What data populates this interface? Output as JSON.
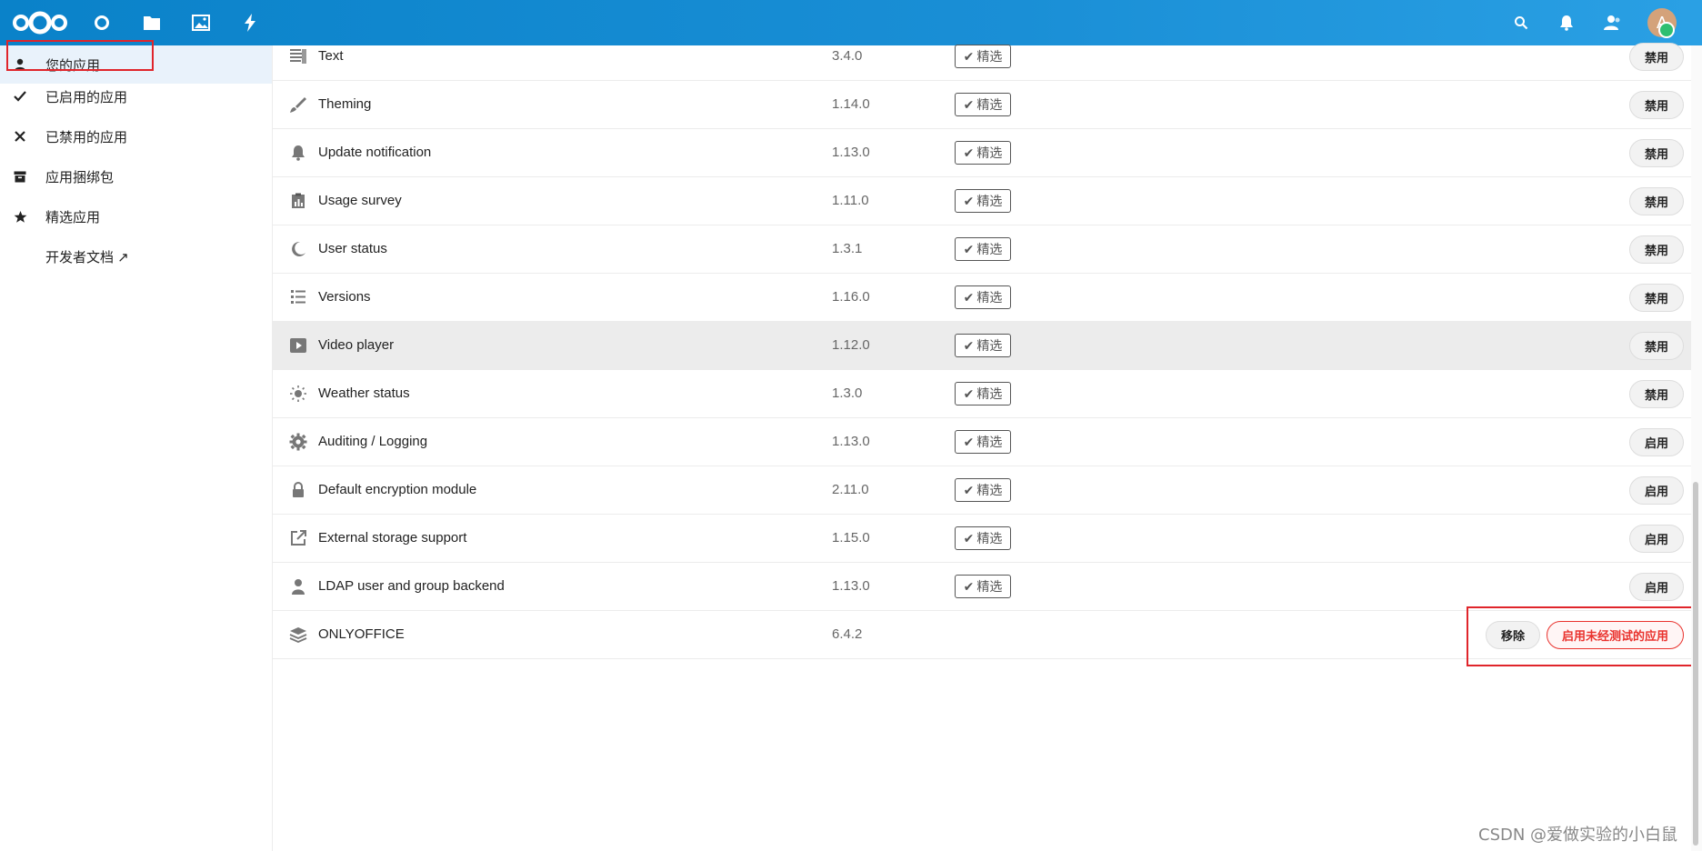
{
  "colors": {
    "header": "#0a82c9",
    "accent": "#e0252b",
    "danger": "#e9322d",
    "online": "#2fbf71"
  },
  "header": {
    "avatar_letter": "A",
    "apps": [
      "dashboard-icon",
      "files-icon",
      "photos-icon",
      "activity-icon"
    ],
    "right": [
      "search-icon",
      "bell-icon",
      "contacts-icon"
    ]
  },
  "sidebar": {
    "items": [
      {
        "label": "您的应用",
        "icon": "user-icon"
      },
      {
        "label": "已启用的应用",
        "icon": "check-icon"
      },
      {
        "label": "已禁用的应用",
        "icon": "close-icon"
      },
      {
        "label": "应用捆绑包",
        "icon": "archive-icon"
      },
      {
        "label": "精选应用",
        "icon": "star-icon"
      },
      {
        "label": "开发者文档 ↗",
        "icon": ""
      }
    ]
  },
  "apps": [
    {
      "name": "Text",
      "version": "3.4.0",
      "badge": "精选",
      "action": "禁用",
      "icon": "text-icon"
    },
    {
      "name": "Theming",
      "version": "1.14.0",
      "badge": "精选",
      "action": "禁用",
      "icon": "brush-icon"
    },
    {
      "name": "Update notification",
      "version": "1.13.0",
      "badge": "精选",
      "action": "禁用",
      "icon": "bell-icon"
    },
    {
      "name": "Usage survey",
      "version": "1.11.0",
      "badge": "精选",
      "action": "禁用",
      "icon": "clipboard-chart-icon"
    },
    {
      "name": "User status",
      "version": "1.3.1",
      "badge": "精选",
      "action": "禁用",
      "icon": "moon-icon"
    },
    {
      "name": "Versions",
      "version": "1.16.0",
      "badge": "精选",
      "action": "禁用",
      "icon": "list-icon"
    },
    {
      "name": "Video player",
      "version": "1.12.0",
      "badge": "精选",
      "action": "禁用",
      "icon": "play-icon"
    },
    {
      "name": "Weather status",
      "version": "1.3.0",
      "badge": "精选",
      "action": "禁用",
      "icon": "sun-icon"
    },
    {
      "name": "Auditing / Logging",
      "version": "1.13.0",
      "badge": "精选",
      "action": "启用",
      "icon": "gear-icon"
    },
    {
      "name": "Default encryption module",
      "version": "2.11.0",
      "badge": "精选",
      "action": "启用",
      "icon": "lock-icon"
    },
    {
      "name": "External storage support",
      "version": "1.15.0",
      "badge": "精选",
      "action": "启用",
      "icon": "external-link-icon"
    },
    {
      "name": "LDAP user and group backend",
      "version": "1.13.0",
      "badge": "精选",
      "action": "启用",
      "icon": "user-icon"
    },
    {
      "name": "ONLYOFFICE",
      "version": "6.4.2",
      "remove": "移除",
      "enable_untested": "启用未经测试的应用",
      "icon": "layers-icon"
    }
  ],
  "watermark": "CSDN @爱做实验的小白鼠"
}
